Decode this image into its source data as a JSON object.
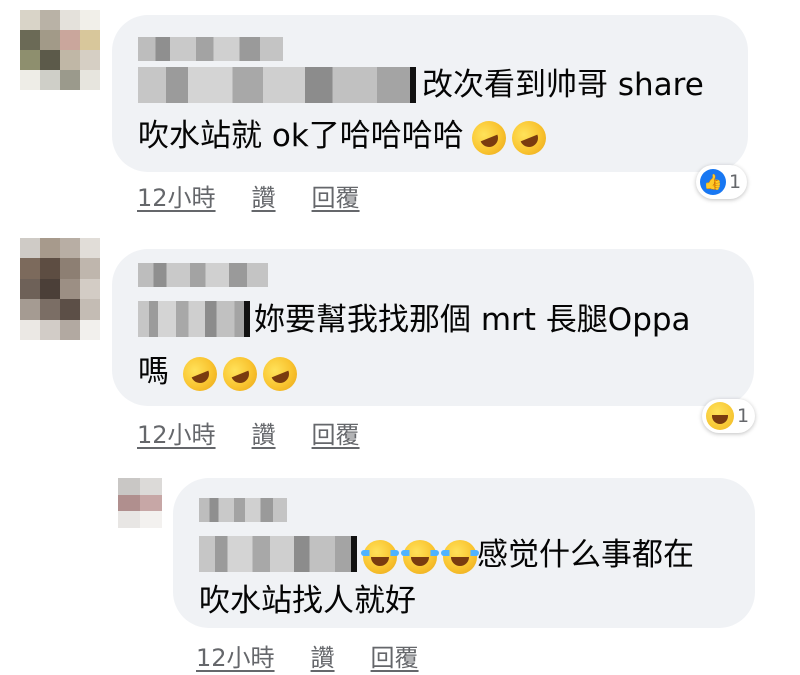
{
  "comments": [
    {
      "text_line1": "改次看到帅哥 share",
      "text_line2": "吹水站就 ok了哈哈哈哈",
      "time": "12小時",
      "like_label": "讚",
      "reply_label": "回覆",
      "reaction": {
        "icon": "like-icon",
        "count": "1"
      }
    },
    {
      "text_line1": "妳要幫我找那個 mrt 長腿Oppa",
      "text_line2": "嗎",
      "time": "12小時",
      "like_label": "讚",
      "reply_label": "回覆",
      "reaction": {
        "icon": "haha-icon",
        "count": "1"
      }
    }
  ],
  "reply": {
    "text_line1": "感觉什么事都在",
    "text_line2": "吹水站找人就好",
    "time": "12小時",
    "like_label": "讚",
    "reply_label": "回覆"
  },
  "colors": {
    "bubble": "#f0f2f5",
    "meta_text": "#65676b",
    "like_blue": "#1877f2"
  }
}
